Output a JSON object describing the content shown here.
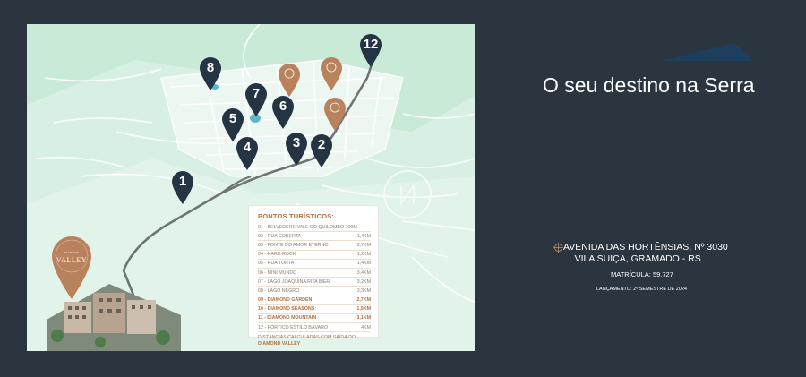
{
  "headline": "O seu destino na Serra",
  "address": {
    "line1": "AVENIDA DAS HORTÊNSIAS, Nº 3030",
    "line2": "VILA SUIÇA, GRAMADO - RS",
    "matricula": "MATRÍCULA: 59.727",
    "lancamento": "LANÇAMENTO: 2º SEMESTRE DE 2024"
  },
  "brand": {
    "small": "DIAMOND",
    "name": "VALLEY"
  },
  "legend": {
    "title": "PONTOS TURÍSTICOS:",
    "items": [
      {
        "label": "01 - BELVEDERE VALE DO QUILOMBO 700M",
        "dist": ""
      },
      {
        "label": "02 - RUA COBERTA",
        "dist": "1,4KM"
      },
      {
        "label": "03 - FONTE DO AMOR ETERNO",
        "dist": "2,7KM"
      },
      {
        "label": "04 - HARD ROCK",
        "dist": "1,2KM"
      },
      {
        "label": "05 - RUA TORTA",
        "dist": "1,4KM"
      },
      {
        "label": "06 - MINI MUNDO",
        "dist": "3,4KM"
      },
      {
        "label": "07 - LAGO JOAQUINA RITA BIER",
        "dist": "3,2KM"
      },
      {
        "label": "08 - LAGO NEGRO",
        "dist": "3,3KM"
      },
      {
        "label": "09 - DIAMOND GARDEN",
        "dist": "2,7KM"
      },
      {
        "label": "10 - DIAMOND SEASONS",
        "dist": "1,9KM"
      },
      {
        "label": "11 - DIAMOND MOUNTAIN",
        "dist": "3,1KM"
      },
      {
        "label": "12 - PÓRTICO ESTILO BÁVARO",
        "dist": "4KM"
      }
    ],
    "note": "DISTÂNCIAS CALCULADAS COM SAÍDA DO",
    "note_bold": "DIAMOND VALLEY"
  },
  "map": {
    "pins": [
      {
        "label": "1",
        "style": "dark"
      },
      {
        "label": "2",
        "style": "dark"
      },
      {
        "label": "3",
        "style": "dark"
      },
      {
        "label": "4",
        "style": "dark"
      },
      {
        "label": "5",
        "style": "dark"
      },
      {
        "label": "6",
        "style": "dark"
      },
      {
        "label": "7",
        "style": "dark"
      },
      {
        "label": "8",
        "style": "dark"
      },
      {
        "label": "12",
        "style": "dark"
      },
      {
        "label": "",
        "style": "copper"
      },
      {
        "label": "",
        "style": "copper"
      },
      {
        "label": "",
        "style": "copper"
      }
    ],
    "colors": {
      "dark_pin": "#253444",
      "copper_pin": "#b9825c",
      "road": "#6e7373",
      "land": "#d8f0e3",
      "water": "#5bb6c9"
    }
  }
}
